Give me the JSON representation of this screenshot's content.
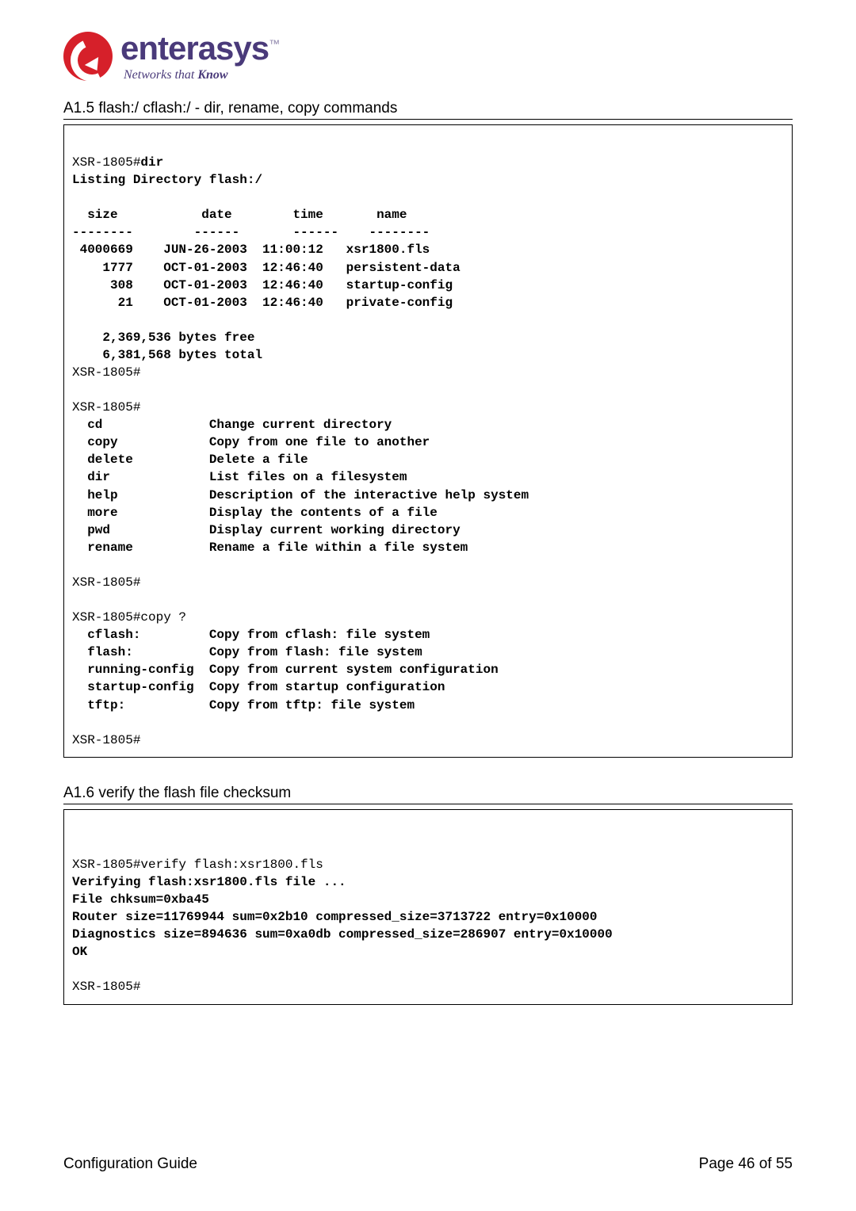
{
  "logo": {
    "brand": "enterasys",
    "tm": "™",
    "tagline_plain": "Networks that ",
    "tagline_bold": "Know"
  },
  "section1": {
    "heading": "A1.5 flash:/ cflash:/ - dir, rename, copy commands",
    "lines": {
      "p1a": "XSR-1805#",
      "p1b": "dir",
      "l2": "Listing Directory flash:/",
      "blank1": "",
      "hdr": "  size           date        time       name",
      "rule": "--------        ------       ------    --------",
      "r1": " 4000669    JUN-26-2003  11:00:12   xsr1800.fls",
      "r2": "    1777    OCT-01-2003  12:46:40   persistent-data",
      "r3": "     308    OCT-01-2003  12:46:40   startup-config",
      "r4": "      21    OCT-01-2003  12:46:40   private-config",
      "blank2": "",
      "free": "    2,369,536 bytes free",
      "total": "    6,381,568 bytes total",
      "p2": "XSR-1805#",
      "blank3": "",
      "p3": "XSR-1805#",
      "cd": "  cd              Change current directory",
      "copy": "  copy            Copy from one file to another",
      "delete": "  delete          Delete a file",
      "dir": "  dir             List files on a filesystem",
      "help": "  help            Description of the interactive help system",
      "more": "  more            Display the contents of a file",
      "pwd": "  pwd             Display current working directory",
      "rename": "  rename          Rename a file within a file system",
      "blank4": "",
      "p4": "XSR-1805#",
      "blank5": "",
      "p5": "XSR-1805#copy ?",
      "cflash": "  cflash:         Copy from cflash: file system",
      "flash": "  flash:          Copy from flash: file system",
      "runcfg": "  running-config  Copy from current system configuration",
      "startcfg": "  startup-config  Copy from startup configuration",
      "tftp": "  tftp:           Copy from tftp: file system",
      "blank6": "",
      "p6": "XSR-1805#"
    }
  },
  "section2": {
    "heading": "A1.6 verify the flash file checksum",
    "lines": {
      "blank0": "",
      "l1": "XSR-1805#verify flash:xsr1800.fls",
      "l2": "Verifying flash:xsr1800.fls file ...",
      "l3": "File chksum=0xba45",
      "l4": "Router size=11769944 sum=0x2b10 compressed_size=3713722 entry=0x10000",
      "l5": "Diagnostics size=894636 sum=0xa0db compressed_size=286907 entry=0x10000",
      "l6": "OK",
      "blank1": "",
      "l7": "XSR-1805#"
    }
  },
  "footer": {
    "left": "Configuration Guide",
    "right": "Page 46 of 55"
  }
}
